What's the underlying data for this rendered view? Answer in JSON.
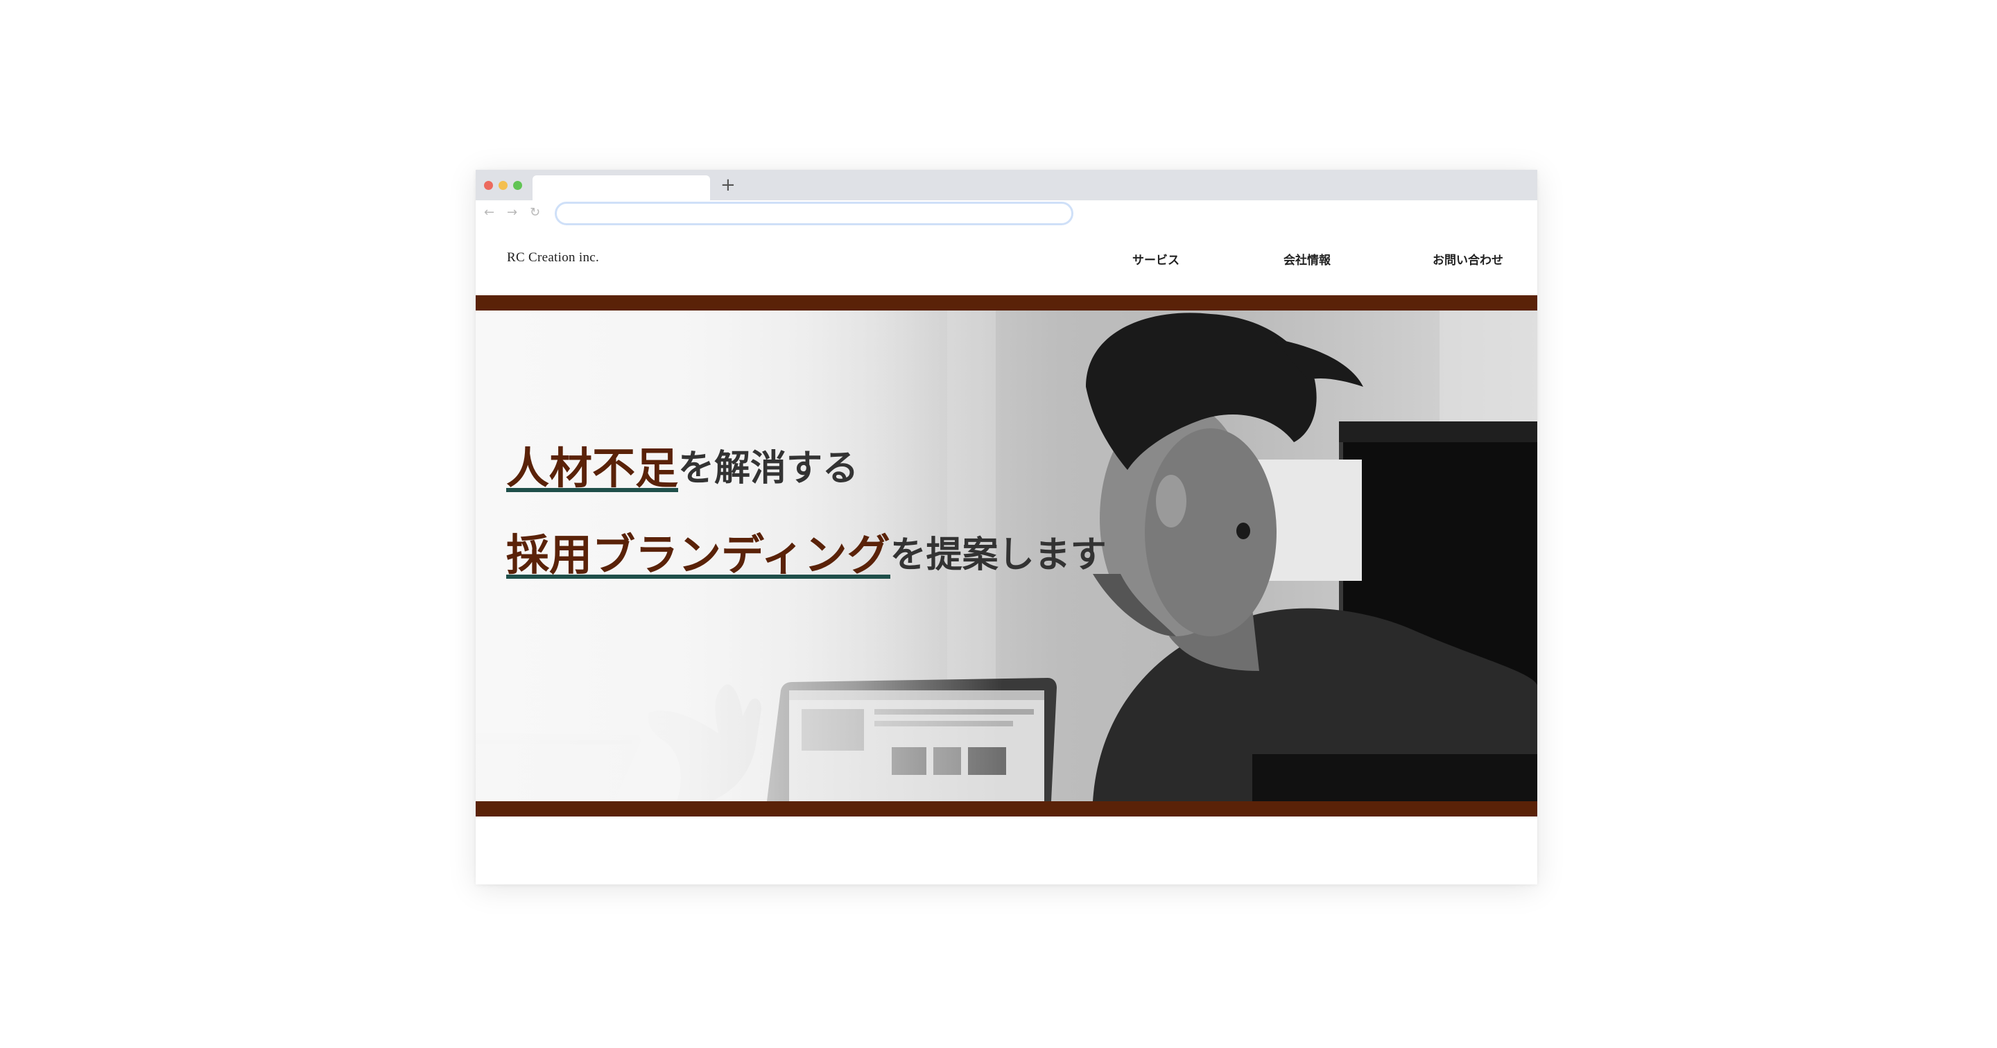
{
  "browser": {
    "new_tab_symbol": "+",
    "back_symbol": "←",
    "forward_symbol": "→",
    "reload_symbol": "↻",
    "address_value": ""
  },
  "site": {
    "logo": "RC Creation inc.",
    "nav": [
      {
        "label": "サービス"
      },
      {
        "label": "会社情報"
      },
      {
        "label": "お問い合わせ"
      }
    ]
  },
  "hero": {
    "line1_accent": "人材不足",
    "line1_rest": "を解消する",
    "line2_accent": "採用ブランディング",
    "line2_rest": "を提案します"
  },
  "colors": {
    "brand_brown": "#5a2208",
    "underline_teal": "#1f4f4a",
    "text_dark": "#333333",
    "traffic_red": "#ec6a5e",
    "traffic_yellow": "#f4bf4f",
    "traffic_green": "#61c454"
  }
}
